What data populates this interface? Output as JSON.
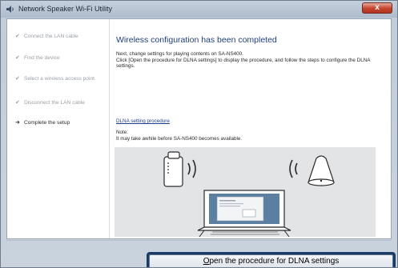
{
  "window": {
    "title": "Network Speaker Wi-Fi Utility",
    "close_label": "x"
  },
  "steps": [
    {
      "label": "Connect the LAN cable",
      "state": "done",
      "mark": "✔"
    },
    {
      "label": "Find the device",
      "state": "done",
      "mark": "✔"
    },
    {
      "label": "Select a wireless access point",
      "state": "done",
      "mark": "✔"
    },
    {
      "label": "Disconnect the LAN cable",
      "state": "done",
      "mark": "✔"
    },
    {
      "label": "Complete the setup",
      "state": "current",
      "mark": "➜"
    }
  ],
  "main": {
    "heading": "Wireless configuration has been completed",
    "desc_line1": "Next, change settings for playing contents on SA-NS400.",
    "desc_line2": "Click [Open the procedure for DLNA settings] to display the procedure, and follow the steps to configure the DLNA settings.",
    "link_label": "DLNA setting procedure",
    "note_title": "Note:",
    "note_body": "It may take awhile before SA-NS400 becomes available."
  },
  "buttons": {
    "open_procedure_accel": "O",
    "open_procedure_rest": "pen the procedure for DLNA settings"
  },
  "colors": {
    "heading": "#1f3f7a",
    "link": "#1c3d8f",
    "button_frame": "#1a3b66",
    "illustration_bg": "#e2e4e6"
  },
  "icons": {
    "app": "speaker-app-icon",
    "done_step": "checkmark-icon",
    "current_step": "arrow-right-icon",
    "close": "close-icon"
  }
}
